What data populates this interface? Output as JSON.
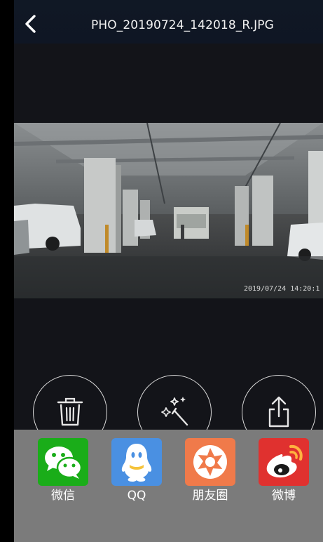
{
  "header": {
    "title": "PHO_20190724_142018_R.JPG",
    "back_icon": "chevron-left-icon"
  },
  "photo": {
    "timestamp": "2019/07/24 14:20:1"
  },
  "actions": [
    {
      "icon": "trash-icon"
    },
    {
      "icon": "magic-wand-icon"
    },
    {
      "icon": "share-icon"
    }
  ],
  "share_sheet": {
    "items": [
      {
        "label": "微信",
        "icon": "wechat-icon",
        "color": "#1aad19"
      },
      {
        "label": "QQ",
        "icon": "qq-icon",
        "color": "#4a90e2"
      },
      {
        "label": "朋友圈",
        "icon": "moments-icon",
        "color": "#f07a4a"
      },
      {
        "label": "微博",
        "icon": "weibo-icon",
        "color": "#e0312f"
      }
    ]
  },
  "colors": {
    "screen_background": "#131419",
    "topbar_background": "#101825",
    "share_sheet_background": "#7b7b7b"
  }
}
